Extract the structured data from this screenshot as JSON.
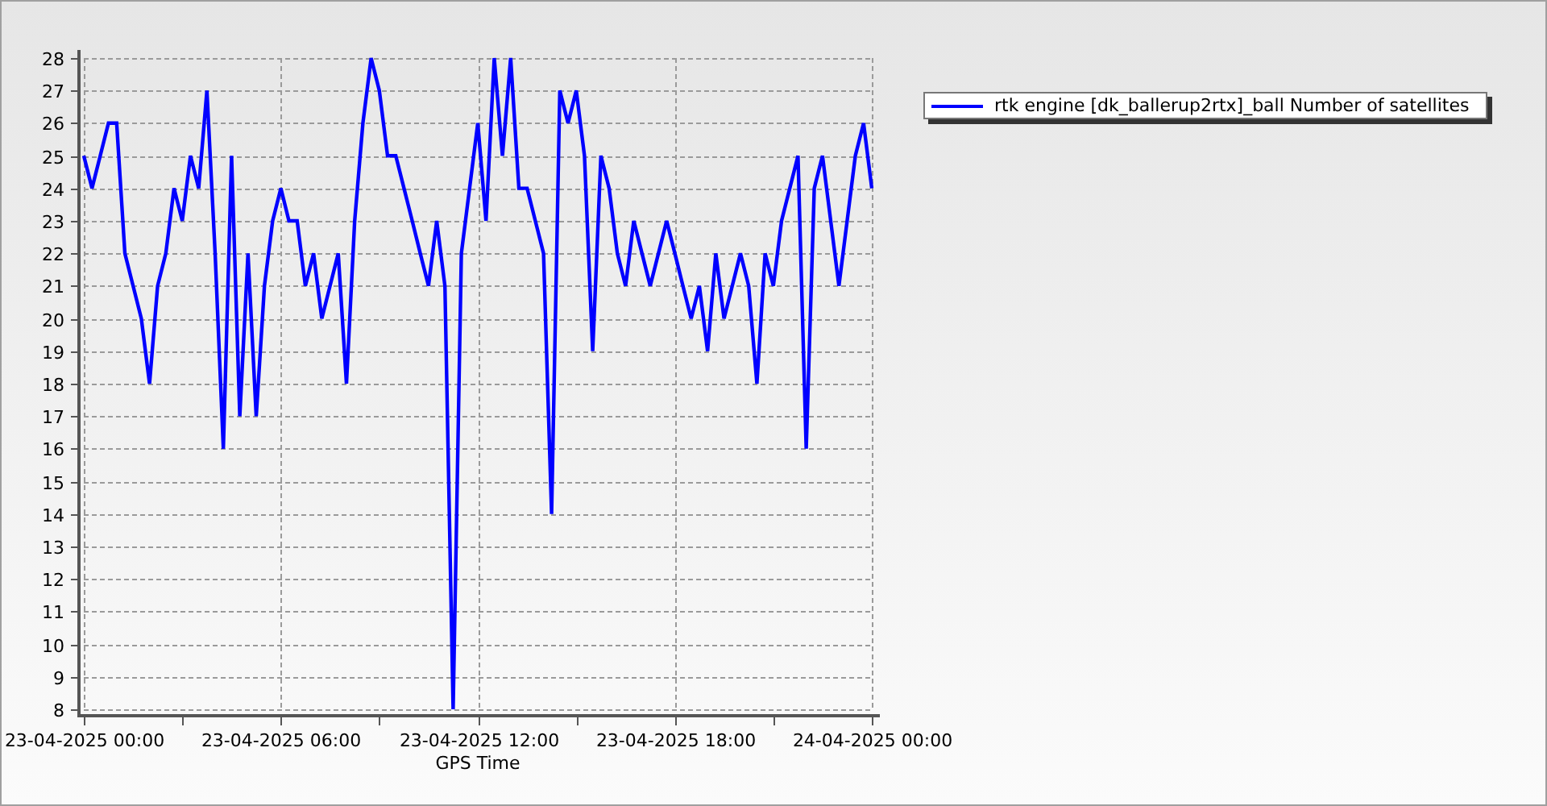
{
  "chart": {
    "chart_data": {
      "type": "line",
      "xlabel": "GPS Time",
      "categories": [
        "23-04-2025 00:00",
        null,
        null,
        null,
        null,
        null,
        null,
        null,
        null,
        null,
        null,
        null,
        null,
        null,
        null,
        null,
        null,
        null,
        null,
        null,
        null,
        null,
        null,
        null,
        "23-04-2025 06:00",
        null,
        null,
        null,
        null,
        null,
        null,
        null,
        null,
        null,
        null,
        null,
        null,
        null,
        null,
        null,
        null,
        null,
        null,
        null,
        null,
        null,
        null,
        null,
        "23-04-2025 12:00",
        null,
        null,
        null,
        null,
        null,
        null,
        null,
        null,
        null,
        null,
        null,
        null,
        null,
        null,
        null,
        null,
        null,
        null,
        null,
        null,
        null,
        null,
        null,
        "23-04-2025 18:00",
        null,
        null,
        null,
        null,
        null,
        null,
        null,
        null,
        null,
        null,
        null,
        null,
        null,
        null,
        null,
        null,
        null,
        null,
        null,
        null,
        null,
        null,
        null,
        "24-04-2025 00:00"
      ],
      "series": [
        {
          "name": "rtk engine [dk_ballerup2rtx]_ball Number of satellites",
          "color": "#0000ff",
          "values": [
            25,
            24,
            25,
            26,
            26,
            22,
            21,
            20,
            18,
            21,
            22,
            24,
            23,
            25,
            24,
            27,
            22,
            16,
            25,
            17,
            22,
            17,
            21,
            23,
            24,
            23,
            23,
            21,
            22,
            20,
            21,
            22,
            18,
            23,
            26,
            28,
            27,
            25,
            25,
            24,
            23,
            22,
            21,
            23,
            21,
            8,
            22,
            24,
            26,
            23,
            28,
            25,
            28,
            24,
            24,
            23,
            22,
            14,
            27,
            26,
            27,
            25,
            19,
            25,
            24,
            22,
            21,
            23,
            22,
            21,
            22,
            23,
            22,
            21,
            20,
            21,
            19,
            22,
            20,
            21,
            22,
            21,
            18,
            22,
            21,
            23,
            24,
            25,
            16,
            24,
            25,
            23,
            21,
            23,
            25,
            26,
            24
          ]
        }
      ],
      "ylim": [
        8,
        28
      ],
      "grid": true,
      "yticks": [
        8,
        9,
        10,
        11,
        12,
        13,
        14,
        15,
        16,
        17,
        18,
        19,
        20,
        21,
        22,
        23,
        24,
        25,
        26,
        27,
        28
      ]
    }
  }
}
